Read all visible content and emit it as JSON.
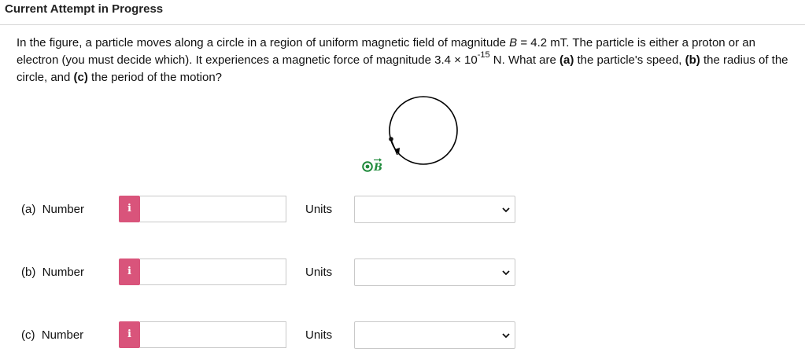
{
  "header": {
    "title": "Current Attempt in Progress"
  },
  "question": {
    "t1": "In the figure, a particle moves along a circle in a region of uniform magnetic field of magnitude ",
    "var_B": "B",
    "t2": " = 4.2 mT. The particle is either a proton or an electron (you must decide which). It experiences a magnetic force of magnitude 3.4 × 10",
    "exponent": "-15",
    "t3": " N. What are ",
    "pa": "(a)",
    "t4": " the particle's speed, ",
    "pb": "(b)",
    "t5": " the radius of the circle, and ",
    "pc": "(c)",
    "t6": " the period of the motion?"
  },
  "figure": {
    "field_symbol": "B",
    "field_direction": "out of page",
    "colors": {
      "field_marker": "#1f8a3b",
      "circle": "#000000"
    }
  },
  "answers": [
    {
      "label": "(a)  Number",
      "units_label": "Units",
      "value": "",
      "units_value": ""
    },
    {
      "label": "(b)  Number",
      "units_label": "Units",
      "value": "",
      "units_value": ""
    },
    {
      "label": "(c)  Number",
      "units_label": "Units",
      "value": "",
      "units_value": ""
    }
  ],
  "info_icon": {
    "glyph": "i",
    "color": "#d9547b"
  }
}
